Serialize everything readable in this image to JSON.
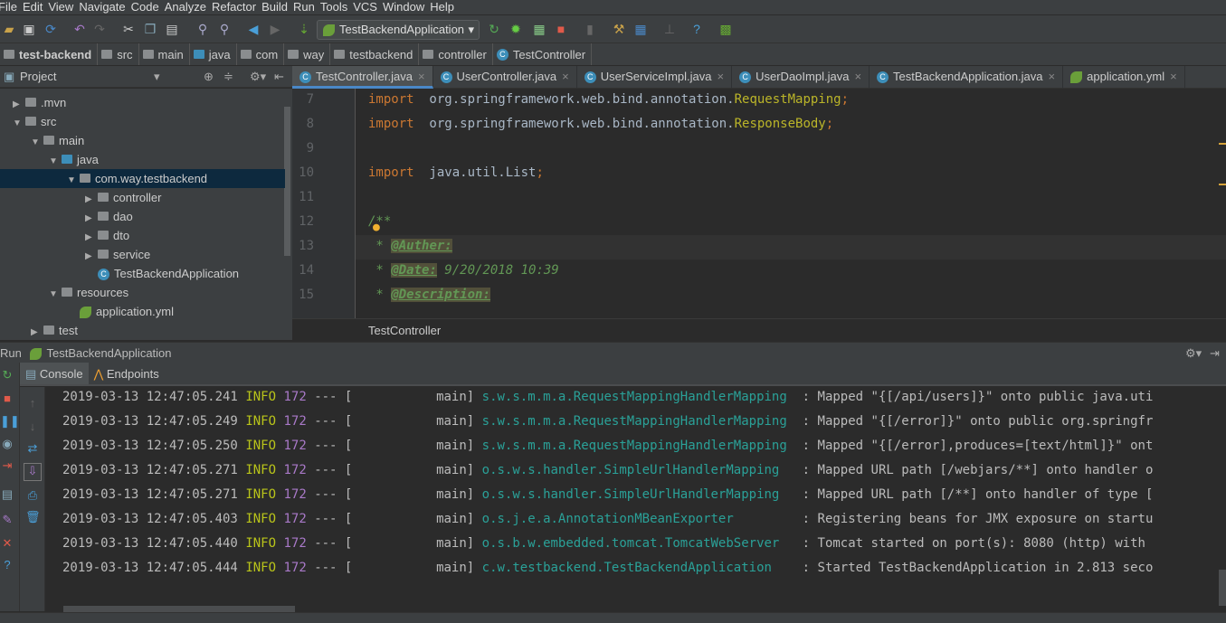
{
  "menu": [
    "File",
    "Edit",
    "View",
    "Navigate",
    "Code",
    "Analyze",
    "Refactor",
    "Build",
    "Run",
    "Tools",
    "VCS",
    "Window",
    "Help"
  ],
  "toolbar": {
    "run_config": "TestBackendApplication"
  },
  "breadcrumb": [
    "test-backend",
    "src",
    "main",
    "java",
    "com",
    "way",
    "testbackend",
    "controller",
    "TestController"
  ],
  "project": {
    "title": "Project",
    "tree": [
      {
        "label": ".mvn",
        "depth": 1,
        "arrow": "right",
        "icon": "folder"
      },
      {
        "label": "src",
        "depth": 1,
        "arrow": "down",
        "icon": "folder"
      },
      {
        "label": "main",
        "depth": 2,
        "arrow": "down",
        "icon": "folder"
      },
      {
        "label": "java",
        "depth": 3,
        "arrow": "down",
        "icon": "folder-blue"
      },
      {
        "label": "com.way.testbackend",
        "depth": 4,
        "arrow": "down",
        "icon": "package",
        "selected": true
      },
      {
        "label": "controller",
        "depth": 5,
        "arrow": "right",
        "icon": "package"
      },
      {
        "label": "dao",
        "depth": 5,
        "arrow": "right",
        "icon": "package"
      },
      {
        "label": "dto",
        "depth": 5,
        "arrow": "right",
        "icon": "package"
      },
      {
        "label": "service",
        "depth": 5,
        "arrow": "right",
        "icon": "package"
      },
      {
        "label": "TestBackendApplication",
        "depth": 5,
        "arrow": "",
        "icon": "class"
      },
      {
        "label": "resources",
        "depth": 3,
        "arrow": "down",
        "icon": "folder"
      },
      {
        "label": "application.yml",
        "depth": 4,
        "arrow": "",
        "icon": "spring"
      },
      {
        "label": "test",
        "depth": 2,
        "arrow": "right",
        "icon": "folder"
      }
    ]
  },
  "tabs": [
    {
      "label": "TestController.java",
      "icon": "class",
      "active": true
    },
    {
      "label": "UserController.java",
      "icon": "class"
    },
    {
      "label": "UserServiceImpl.java",
      "icon": "class"
    },
    {
      "label": "UserDaoImpl.java",
      "icon": "class"
    },
    {
      "label": "TestBackendApplication.java",
      "icon": "class"
    },
    {
      "label": "application.yml",
      "icon": "spring"
    }
  ],
  "editor": {
    "lines": [
      {
        "n": "7",
        "parts": [
          [
            "kw",
            "import"
          ],
          [
            "",
            "  org.springframework.web.bind.annotation."
          ],
          [
            "cls",
            "RequestMapping"
          ],
          [
            "kw",
            ";"
          ]
        ]
      },
      {
        "n": "8",
        "parts": [
          [
            "kw",
            "import"
          ],
          [
            "",
            "  org.springframework.web.bind.annotation."
          ],
          [
            "cls",
            "ResponseBody"
          ],
          [
            "kw",
            ";"
          ]
        ]
      },
      {
        "n": "9",
        "parts": []
      },
      {
        "n": "10",
        "parts": [
          [
            "kw",
            "import"
          ],
          [
            "",
            "  java.util.List"
          ],
          [
            "kw",
            ";"
          ]
        ]
      },
      {
        "n": "11",
        "parts": []
      },
      {
        "n": "12",
        "parts": [
          [
            "cm",
            "/**"
          ]
        ]
      },
      {
        "n": "13",
        "parts": [
          [
            "cm",
            " * "
          ],
          [
            "tag",
            "@Auther:"
          ]
        ]
      },
      {
        "n": "14",
        "parts": [
          [
            "cm",
            " * "
          ],
          [
            "tag",
            "@Date:"
          ],
          [
            "cm",
            " 9/20/2018 10:39"
          ]
        ]
      },
      {
        "n": "15",
        "parts": [
          [
            "cm",
            " * "
          ],
          [
            "tag",
            "@Description:"
          ]
        ]
      }
    ],
    "breadcrumb": "TestController"
  },
  "run": {
    "title": "Run",
    "config": "TestBackendApplication",
    "tabs": [
      "Console",
      "Endpoints"
    ]
  },
  "console": [
    {
      "ts": "2019-03-13 12:47:05.241",
      "lvl": "INFO",
      "pid": "172",
      "th": "main",
      "logger": "s.w.s.m.m.a.RequestMappingHandlerMapping ",
      "msg": ": Mapped \"{[/api/users]}\" onto public java.uti"
    },
    {
      "ts": "2019-03-13 12:47:05.249",
      "lvl": "INFO",
      "pid": "172",
      "th": "main",
      "logger": "s.w.s.m.m.a.RequestMappingHandlerMapping ",
      "msg": ": Mapped \"{[/error]}\" onto public org.springfr"
    },
    {
      "ts": "2019-03-13 12:47:05.250",
      "lvl": "INFO",
      "pid": "172",
      "th": "main",
      "logger": "s.w.s.m.m.a.RequestMappingHandlerMapping ",
      "msg": ": Mapped \"{[/error],produces=[text/html]}\" ont"
    },
    {
      "ts": "2019-03-13 12:47:05.271",
      "lvl": "INFO",
      "pid": "172",
      "th": "main",
      "logger": "o.s.w.s.handler.SimpleUrlHandlerMapping  ",
      "msg": ": Mapped URL path [/webjars/**] onto handler o"
    },
    {
      "ts": "2019-03-13 12:47:05.271",
      "lvl": "INFO",
      "pid": "172",
      "th": "main",
      "logger": "o.s.w.s.handler.SimpleUrlHandlerMapping  ",
      "msg": ": Mapped URL path [/**] onto handler of type ["
    },
    {
      "ts": "2019-03-13 12:47:05.403",
      "lvl": "INFO",
      "pid": "172",
      "th": "main",
      "logger": "o.s.j.e.a.AnnotationMBeanExporter        ",
      "msg": ": Registering beans for JMX exposure on startu"
    },
    {
      "ts": "2019-03-13 12:47:05.440",
      "lvl": "INFO",
      "pid": "172",
      "th": "main",
      "logger": "o.s.b.w.embedded.tomcat.TomcatWebServer  ",
      "msg": ": Tomcat started on port(s): 8080 (http) with"
    },
    {
      "ts": "2019-03-13 12:47:05.444",
      "lvl": "INFO",
      "pid": "172",
      "th": "main",
      "logger": "c.w.testbackend.TestBackendApplication   ",
      "msg": ": Started TestBackendApplication in 2.813 seco"
    }
  ]
}
